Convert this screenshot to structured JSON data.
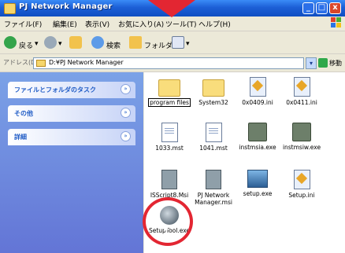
{
  "window": {
    "title": "PJ Network Manager",
    "minimize": "_",
    "maximize": "□",
    "close": "x"
  },
  "menu": [
    "ファイル(F)",
    "編集(E)",
    "表示(V)",
    "お気に入り(A)",
    "ツール(T)",
    "ヘルプ(H)"
  ],
  "toolbar": {
    "back_label": "戻る",
    "search_label": "検索",
    "folders_label": "フォルダ"
  },
  "address": {
    "label": "アドレス(D)",
    "path": "D:¥PJ Network Manager",
    "go_label": "移動"
  },
  "taskpane": [
    {
      "label": "ファイルとフォルダのタスク"
    },
    {
      "label": "その他"
    },
    {
      "label": "詳細"
    }
  ],
  "files": [
    {
      "name": "program files",
      "type": "folder"
    },
    {
      "name": "System32",
      "type": "folder"
    },
    {
      "name": "0x0409.ini",
      "type": "ini"
    },
    {
      "name": "0x0411.ini",
      "type": "ini"
    },
    {
      "name": "1033.mst",
      "type": "doc"
    },
    {
      "name": "1041.mst",
      "type": "doc"
    },
    {
      "name": "instmsia.exe",
      "type": "exe"
    },
    {
      "name": "instmsiw.exe",
      "type": "exe"
    },
    {
      "name": "ISScript8.Msi",
      "type": "msi"
    },
    {
      "name": "PJ Network Manager.msi",
      "type": "msi"
    },
    {
      "name": "setup.exe",
      "type": "setupexe"
    },
    {
      "name": "Setup.ini",
      "type": "ini"
    },
    {
      "name": "SetupTool.exe",
      "type": "setuptool"
    }
  ],
  "colors": {
    "titlebar": "#1c5fd6",
    "taskpane": "#6d8ee0",
    "highlight_circle": "#e32632"
  }
}
